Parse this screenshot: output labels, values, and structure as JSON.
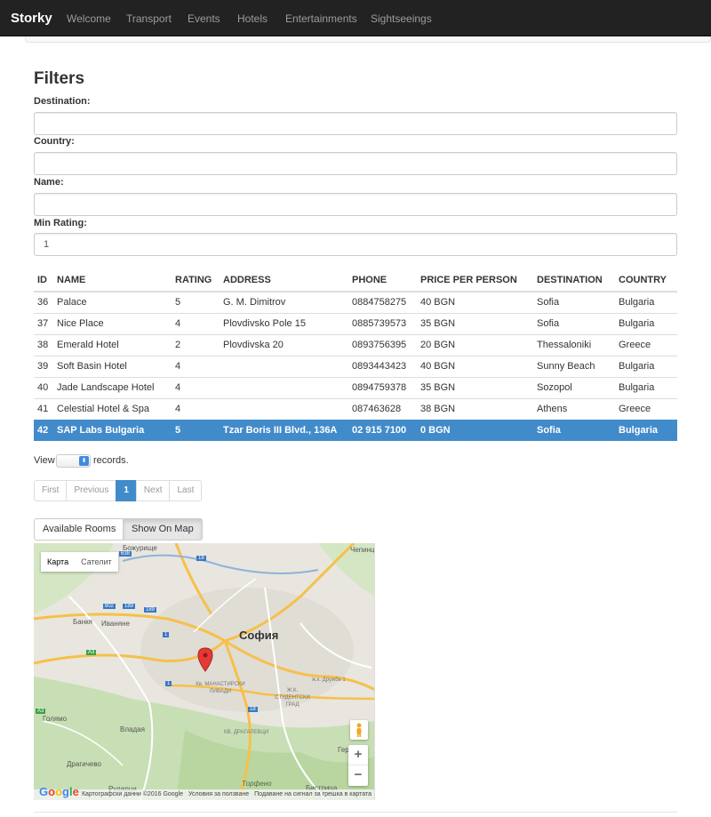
{
  "navbar": {
    "brand": "Storky",
    "items": [
      "Welcome",
      "Transport",
      "Events",
      "Hotels",
      "Entertainments",
      "Sightseeings"
    ]
  },
  "filters": {
    "title": "Filters",
    "destination_label": "Destination:",
    "destination_value": "",
    "country_label": "Country:",
    "country_value": "",
    "name_label": "Name:",
    "name_value": "",
    "min_rating_label": "Min Rating:",
    "min_rating_value": "1"
  },
  "table": {
    "headers": [
      "ID",
      "NAME",
      "RATING",
      "ADDRESS",
      "PHONE",
      "PRICE PER PERSON",
      "DESTINATION",
      "COUNTRY"
    ],
    "rows": [
      [
        "36",
        "Palace",
        "5",
        "G. M. Dimitrov",
        "0884758275",
        "40 BGN",
        "Sofia",
        "Bulgaria"
      ],
      [
        "37",
        "Nice Place",
        "4",
        "Plovdivsko Pole 15",
        "0885739573",
        "35 BGN",
        "Sofia",
        "Bulgaria"
      ],
      [
        "38",
        "Emerald Hotel",
        "2",
        "Plovdivska 20",
        "0893756395",
        "20 BGN",
        "Thessaloniki",
        "Greece"
      ],
      [
        "39",
        "Soft Basin Hotel",
        "4",
        "",
        "0893443423",
        "40 BGN",
        "Sunny Beach",
        "Bulgaria"
      ],
      [
        "40",
        "Jade Landscape Hotel",
        "4",
        "",
        "0894759378",
        "35 BGN",
        "Sozopol",
        "Bulgaria"
      ],
      [
        "41",
        "Celestial Hotel & Spa",
        "4",
        "",
        "087463628",
        "38 BGN",
        "Athens",
        "Greece"
      ],
      [
        "42",
        "SAP Labs Bulgaria",
        "5",
        "Tzar Boris III Blvd., 136A",
        "02 915 7100",
        "0 BGN",
        "Sofia",
        "Bulgaria"
      ]
    ],
    "selected_row": 6
  },
  "view": {
    "prefix": "View",
    "suffix": "records."
  },
  "pager": {
    "first": "First",
    "previous": "Previous",
    "current": "1",
    "next": "Next",
    "last": "Last"
  },
  "buttons": {
    "available_rooms": "Available Rooms",
    "show_on_map": "Show On Map"
  },
  "map": {
    "type_map": "Карта",
    "type_satellite": "Сателит",
    "city_label": "София",
    "place_labels": [
      "Божурище",
      "Банкя",
      "Иваняне",
      "Голямо",
      "Владая",
      "Драгичево",
      "Кв. МАНАСТИРСКИ ЛИВАДИ",
      "Ж.К. СТУДЕНТСКИ ГРАД",
      "КВ. ДРАГАЛЕВЦИ",
      "ж.к. Дружба 1",
      "Торфено",
      "Бистрица",
      "Чепинци",
      "Герман",
      "Рударци"
    ],
    "road_labels": [
      "638",
      "18",
      "802",
      "189",
      "189",
      "A3",
      "A3",
      "1",
      "1",
      "18"
    ],
    "zoom_in": "+",
    "zoom_out": "−",
    "google_logo": "Google",
    "attribution": [
      "Картографски данни ©2016 Google",
      "Условия за ползване",
      "Подаване на сигнал за грешка в картата"
    ]
  },
  "colors": {
    "navbar_bg": "#222222",
    "selected_row": "#428bca",
    "marker": "#e53935"
  }
}
